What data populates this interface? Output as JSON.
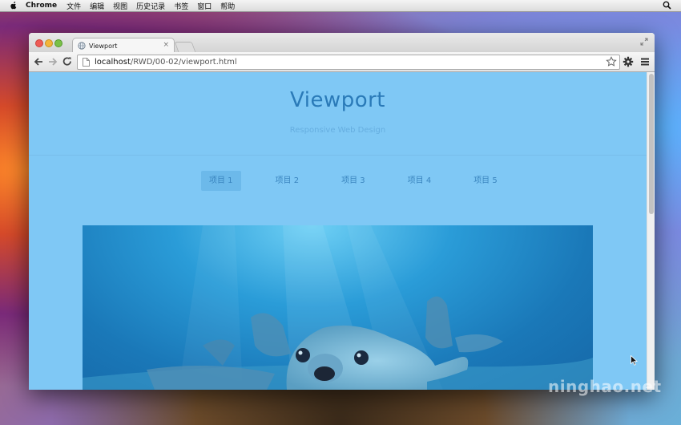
{
  "menubar": {
    "app_name": "Chrome",
    "items": [
      "文件",
      "编辑",
      "视图",
      "历史记录",
      "书签",
      "窗口",
      "帮助"
    ]
  },
  "browser": {
    "tab_title": "Viewport",
    "tab_close": "×",
    "url_host": "localhost",
    "url_path": "/RWD/00-02/viewport.html"
  },
  "page": {
    "title": "Viewport",
    "subtitle": "Responsive Web Design",
    "nav": [
      "项目 1",
      "项目 2",
      "项目 3",
      "项目 4",
      "项目 5"
    ],
    "active_nav_index": 0,
    "hero_image_icon": "sea-lion-underwater-photo"
  },
  "watermark": "ninghao.net",
  "colors": {
    "page_bg": "#7fc8f5",
    "title": "#2a7ab8",
    "nav_text": "#3a85bf",
    "nav_active_bg": "#6cb9ea"
  }
}
